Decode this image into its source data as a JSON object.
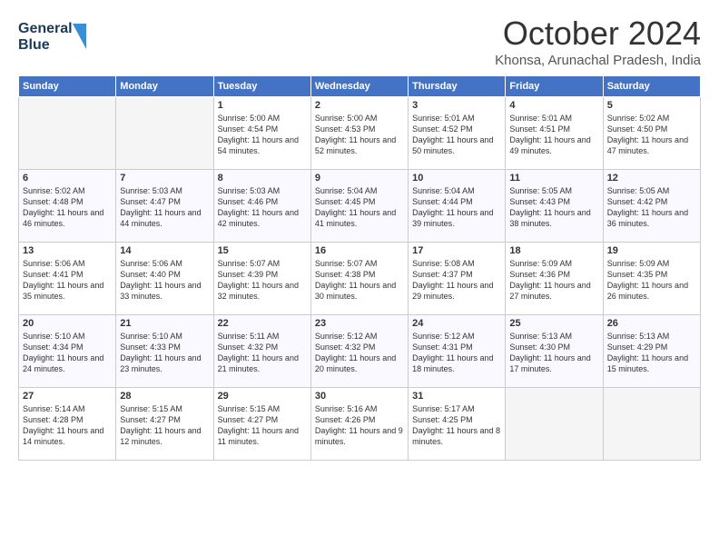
{
  "header": {
    "logo_line1": "General",
    "logo_line2": "Blue",
    "month": "October 2024",
    "location": "Khonsa, Arunachal Pradesh, India"
  },
  "days_of_week": [
    "Sunday",
    "Monday",
    "Tuesday",
    "Wednesday",
    "Thursday",
    "Friday",
    "Saturday"
  ],
  "weeks": [
    [
      {
        "day": null
      },
      {
        "day": null
      },
      {
        "day": "1",
        "sunrise": "Sunrise: 5:00 AM",
        "sunset": "Sunset: 4:54 PM",
        "daylight": "Daylight: 11 hours and 54 minutes."
      },
      {
        "day": "2",
        "sunrise": "Sunrise: 5:00 AM",
        "sunset": "Sunset: 4:53 PM",
        "daylight": "Daylight: 11 hours and 52 minutes."
      },
      {
        "day": "3",
        "sunrise": "Sunrise: 5:01 AM",
        "sunset": "Sunset: 4:52 PM",
        "daylight": "Daylight: 11 hours and 50 minutes."
      },
      {
        "day": "4",
        "sunrise": "Sunrise: 5:01 AM",
        "sunset": "Sunset: 4:51 PM",
        "daylight": "Daylight: 11 hours and 49 minutes."
      },
      {
        "day": "5",
        "sunrise": "Sunrise: 5:02 AM",
        "sunset": "Sunset: 4:50 PM",
        "daylight": "Daylight: 11 hours and 47 minutes."
      }
    ],
    [
      {
        "day": "6",
        "sunrise": "Sunrise: 5:02 AM",
        "sunset": "Sunset: 4:48 PM",
        "daylight": "Daylight: 11 hours and 46 minutes."
      },
      {
        "day": "7",
        "sunrise": "Sunrise: 5:03 AM",
        "sunset": "Sunset: 4:47 PM",
        "daylight": "Daylight: 11 hours and 44 minutes."
      },
      {
        "day": "8",
        "sunrise": "Sunrise: 5:03 AM",
        "sunset": "Sunset: 4:46 PM",
        "daylight": "Daylight: 11 hours and 42 minutes."
      },
      {
        "day": "9",
        "sunrise": "Sunrise: 5:04 AM",
        "sunset": "Sunset: 4:45 PM",
        "daylight": "Daylight: 11 hours and 41 minutes."
      },
      {
        "day": "10",
        "sunrise": "Sunrise: 5:04 AM",
        "sunset": "Sunset: 4:44 PM",
        "daylight": "Daylight: 11 hours and 39 minutes."
      },
      {
        "day": "11",
        "sunrise": "Sunrise: 5:05 AM",
        "sunset": "Sunset: 4:43 PM",
        "daylight": "Daylight: 11 hours and 38 minutes."
      },
      {
        "day": "12",
        "sunrise": "Sunrise: 5:05 AM",
        "sunset": "Sunset: 4:42 PM",
        "daylight": "Daylight: 11 hours and 36 minutes."
      }
    ],
    [
      {
        "day": "13",
        "sunrise": "Sunrise: 5:06 AM",
        "sunset": "Sunset: 4:41 PM",
        "daylight": "Daylight: 11 hours and 35 minutes."
      },
      {
        "day": "14",
        "sunrise": "Sunrise: 5:06 AM",
        "sunset": "Sunset: 4:40 PM",
        "daylight": "Daylight: 11 hours and 33 minutes."
      },
      {
        "day": "15",
        "sunrise": "Sunrise: 5:07 AM",
        "sunset": "Sunset: 4:39 PM",
        "daylight": "Daylight: 11 hours and 32 minutes."
      },
      {
        "day": "16",
        "sunrise": "Sunrise: 5:07 AM",
        "sunset": "Sunset: 4:38 PM",
        "daylight": "Daylight: 11 hours and 30 minutes."
      },
      {
        "day": "17",
        "sunrise": "Sunrise: 5:08 AM",
        "sunset": "Sunset: 4:37 PM",
        "daylight": "Daylight: 11 hours and 29 minutes."
      },
      {
        "day": "18",
        "sunrise": "Sunrise: 5:09 AM",
        "sunset": "Sunset: 4:36 PM",
        "daylight": "Daylight: 11 hours and 27 minutes."
      },
      {
        "day": "19",
        "sunrise": "Sunrise: 5:09 AM",
        "sunset": "Sunset: 4:35 PM",
        "daylight": "Daylight: 11 hours and 26 minutes."
      }
    ],
    [
      {
        "day": "20",
        "sunrise": "Sunrise: 5:10 AM",
        "sunset": "Sunset: 4:34 PM",
        "daylight": "Daylight: 11 hours and 24 minutes."
      },
      {
        "day": "21",
        "sunrise": "Sunrise: 5:10 AM",
        "sunset": "Sunset: 4:33 PM",
        "daylight": "Daylight: 11 hours and 23 minutes."
      },
      {
        "day": "22",
        "sunrise": "Sunrise: 5:11 AM",
        "sunset": "Sunset: 4:32 PM",
        "daylight": "Daylight: 11 hours and 21 minutes."
      },
      {
        "day": "23",
        "sunrise": "Sunrise: 5:12 AM",
        "sunset": "Sunset: 4:32 PM",
        "daylight": "Daylight: 11 hours and 20 minutes."
      },
      {
        "day": "24",
        "sunrise": "Sunrise: 5:12 AM",
        "sunset": "Sunset: 4:31 PM",
        "daylight": "Daylight: 11 hours and 18 minutes."
      },
      {
        "day": "25",
        "sunrise": "Sunrise: 5:13 AM",
        "sunset": "Sunset: 4:30 PM",
        "daylight": "Daylight: 11 hours and 17 minutes."
      },
      {
        "day": "26",
        "sunrise": "Sunrise: 5:13 AM",
        "sunset": "Sunset: 4:29 PM",
        "daylight": "Daylight: 11 hours and 15 minutes."
      }
    ],
    [
      {
        "day": "27",
        "sunrise": "Sunrise: 5:14 AM",
        "sunset": "Sunset: 4:28 PM",
        "daylight": "Daylight: 11 hours and 14 minutes."
      },
      {
        "day": "28",
        "sunrise": "Sunrise: 5:15 AM",
        "sunset": "Sunset: 4:27 PM",
        "daylight": "Daylight: 11 hours and 12 minutes."
      },
      {
        "day": "29",
        "sunrise": "Sunrise: 5:15 AM",
        "sunset": "Sunset: 4:27 PM",
        "daylight": "Daylight: 11 hours and 11 minutes."
      },
      {
        "day": "30",
        "sunrise": "Sunrise: 5:16 AM",
        "sunset": "Sunset: 4:26 PM",
        "daylight": "Daylight: 11 hours and 9 minutes."
      },
      {
        "day": "31",
        "sunrise": "Sunrise: 5:17 AM",
        "sunset": "Sunset: 4:25 PM",
        "daylight": "Daylight: 11 hours and 8 minutes."
      },
      {
        "day": null
      },
      {
        "day": null
      }
    ]
  ]
}
